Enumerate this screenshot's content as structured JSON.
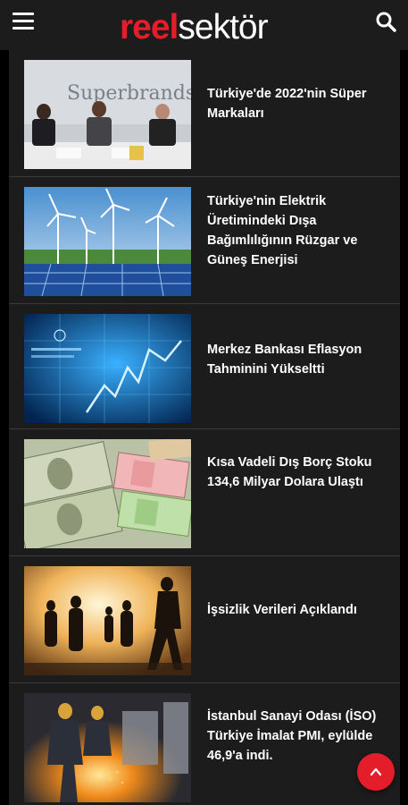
{
  "header": {
    "logo_part1": "reel",
    "logo_part2": "sektör",
    "menu_icon": "hamburger-menu-icon",
    "search_icon": "search-icon"
  },
  "articles": [
    {
      "title": "Türkiye'de 2022'nin Süper Markaları",
      "image": "superbrands-panel-photo",
      "image_text": "Superbrands"
    },
    {
      "title": "Türkiye'nin Elektrik Üretimindeki Dışa Bağımlılığının Rüzgar ve Güneş Enerjisi",
      "image": "wind-turbines-solar-panels-photo"
    },
    {
      "title": "Merkez Bankası Eflasyon Tahminini Yükseltti",
      "image": "central-bank-digital-graph-photo"
    },
    {
      "title": "Kısa Vadeli Dış Borç Stoku 134,6 Milyar Dolara Ulaştı",
      "image": "dollar-euro-banknotes-photo"
    },
    {
      "title": "İşsizlik Verileri Açıklandı",
      "image": "silhouettes-walking-people-photo"
    },
    {
      "title": "İstanbul Sanayi Odası (İSO) Türkiye İmalat PMI, eylülde 46,9'a indi.",
      "image": "industrial-welding-worker-photo"
    }
  ],
  "back_to_top_icon": "chevron-up-icon",
  "colors": {
    "brand_red": "#e41d2b",
    "card_bg": "#1c1c1c",
    "page_bg": "#000000"
  }
}
